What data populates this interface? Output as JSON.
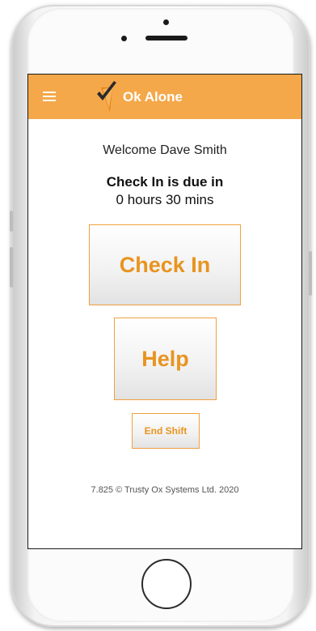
{
  "app": {
    "title": "Ok Alone",
    "brand_color": "#f4a84a",
    "accent_color": "#e8941f"
  },
  "header": {
    "menu_icon": "hamburger-menu-icon",
    "logo_icon": "ok-alone-checkmark-logo-icon"
  },
  "main": {
    "welcome_text": "Welcome Dave Smith",
    "checkin_due_label": "Check In is due in",
    "checkin_due_time": "0 hours 30 mins",
    "checkin_button_label": "Check In",
    "help_button_label": "Help",
    "end_shift_button_label": "End Shift"
  },
  "footer": {
    "version_text": "7.825 © Trusty Ox Systems Ltd. 2020"
  },
  "device": {
    "home_button_icon": "home-button-icon"
  }
}
